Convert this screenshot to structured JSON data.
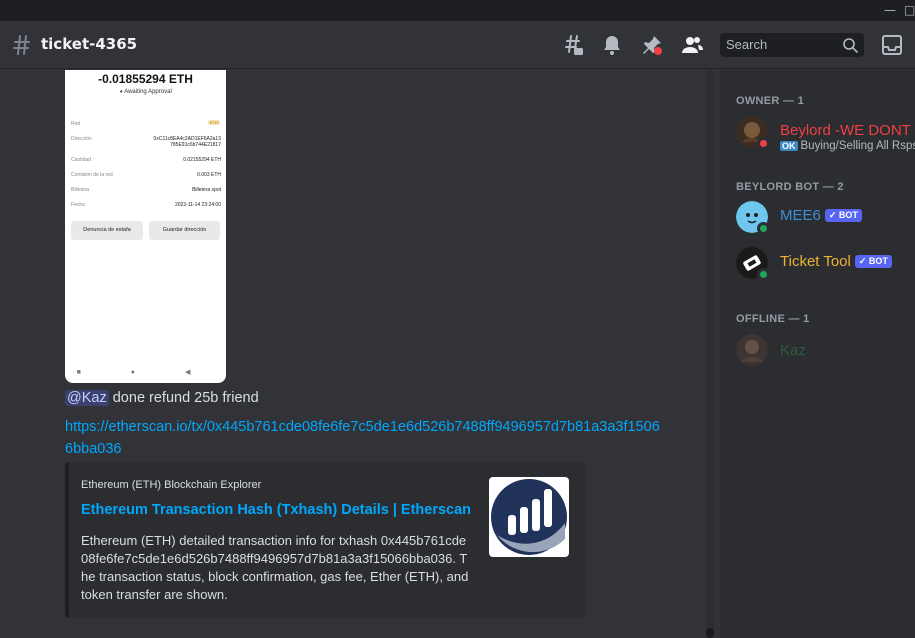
{
  "window": {
    "minimize": "—",
    "maximize": "□"
  },
  "header": {
    "channel_name": "ticket-4365",
    "search_placeholder": "Search"
  },
  "screenshot_image": {
    "amount": "-0.01855294 ETH",
    "status": "Awaiting Approval",
    "badge": "ETH",
    "rows": [
      {
        "label": "Red",
        "value": ""
      },
      {
        "label": "Dirección",
        "value": "0xC11c8EA4c2AD1EF6A2a13 785E91c6b744E21817"
      },
      {
        "label": "Cantidad",
        "value": "0.02155294 ETH"
      },
      {
        "label": "Comisión de la red",
        "value": "0.003 ETH"
      },
      {
        "label": "Billetera",
        "value": "Billetera spot"
      },
      {
        "label": "Fecha",
        "value": "2023-11-14 23:24:00"
      }
    ],
    "buttons": [
      "Denuncia de estafa",
      "Guardar dirección"
    ],
    "navbar": "■ ● ◀"
  },
  "message": {
    "mention": "@Kaz",
    "text": " done refund 25b friend",
    "link": "https://etherscan.io/tx/0x445b761cde08fe6fe7c5de1e6d526b7488ff9496957d7b81a3a3f15066bba036"
  },
  "embed": {
    "provider": "Ethereum (ETH) Blockchain Explorer",
    "title": "Ethereum Transaction Hash (Txhash) Details | Etherscan",
    "description": "Ethereum (ETH) detailed transaction info for txhash 0x445b761cde08fe6fe7c5de1e6d526b7488ff9496957d7b81a3a3f15066bba036. The transaction status, block confirmation, gas fee, Ether (ETH), and token transfer are shown."
  },
  "members": {
    "sections": [
      {
        "title": "OWNER — 1"
      },
      {
        "title": "BEYLORD BOT — 2"
      },
      {
        "title": "OFFLINE — 1"
      }
    ],
    "owner": {
      "name": "Beylord -WE DONT",
      "status_badge": "OK",
      "status": "Buying/Selling All Rsps",
      "name_color": "#f23f43"
    },
    "bots": [
      {
        "name": "MEE6",
        "badge": "✓ BOT",
        "name_color": "#3a8fd6"
      },
      {
        "name": "Ticket Tool",
        "badge": "✓ BOT",
        "name_color": "#f0b232"
      }
    ],
    "offline": {
      "name": "Kaz",
      "name_color": "#2d7d46"
    }
  },
  "colors": {
    "link": "#00a8fc",
    "background": "#313338",
    "sidebar": "#2b2d31"
  }
}
